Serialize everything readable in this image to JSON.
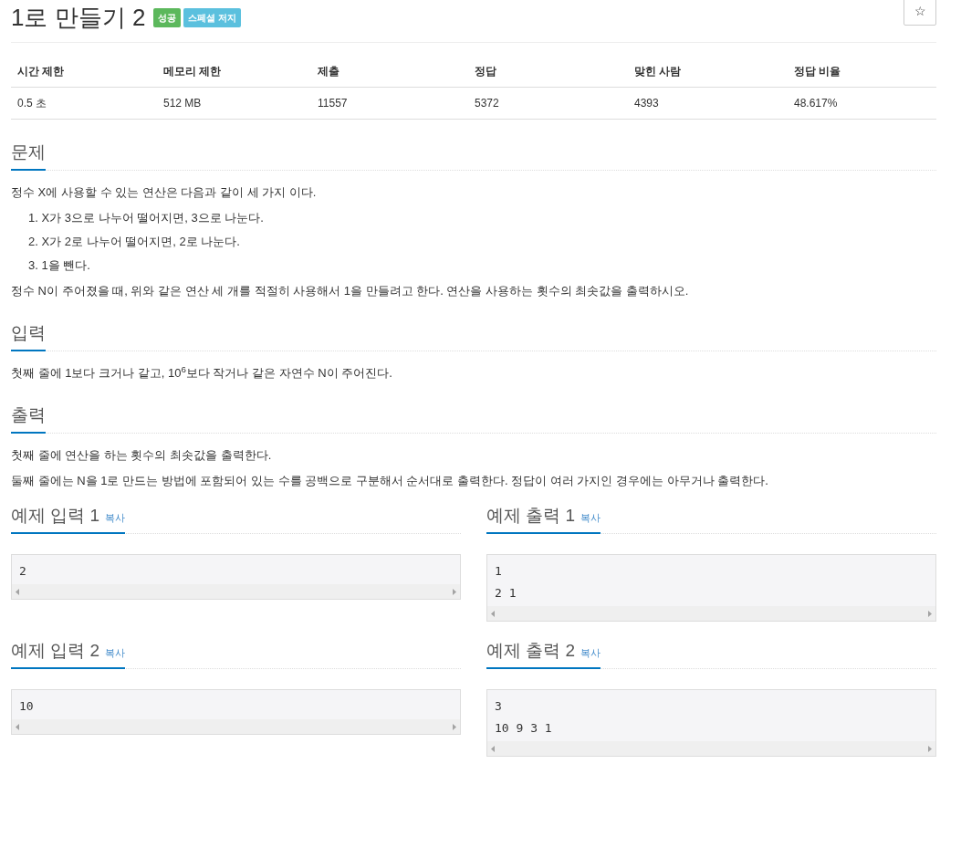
{
  "title": "1로 만들기 2",
  "badges": [
    {
      "label": "성공",
      "color": "#5cb85c"
    },
    {
      "label": "스페셜 저지",
      "color": "#5bc0de"
    }
  ],
  "star_button": "☆",
  "stats": {
    "columns": [
      "시간 제한",
      "메모리 제한",
      "제출",
      "정답",
      "맞힌 사람",
      "정답 비율"
    ],
    "values": [
      "0.5 초",
      "512 MB",
      "11557",
      "5372",
      "4393",
      "48.617%"
    ]
  },
  "sections": [
    {
      "heading": "문제",
      "blocks": [
        {
          "kind": "paragraph",
          "text": "정수 X에 사용할 수 있는 연산은 다음과 같이 세 가지 이다."
        },
        {
          "kind": "list",
          "items": [
            "1. X가 3으로 나누어 떨어지면, 3으로 나눈다.",
            "2. X가 2로 나누어 떨어지면, 2로 나눈다.",
            "3. 1을 뺀다."
          ]
        },
        {
          "kind": "paragraph",
          "text": "정수 N이 주어졌을 때, 위와 같은 연산 세 개를 적절히 사용해서 1을 만들려고 한다. 연산을 사용하는 횟수의 최솟값을 출력하시오."
        }
      ]
    },
    {
      "heading": "입력",
      "blocks": [
        {
          "kind": "paragraph",
          "text": "첫째 줄에 1보다 크거나 같고, 10$^{6}$보다 작거나 같은 자연수 N이 주어진다."
        }
      ]
    },
    {
      "heading": "출력",
      "blocks": [
        {
          "kind": "paragraph",
          "text": "첫째 줄에 연산을 하는 횟수의 최솟값을 출력한다."
        },
        {
          "kind": "paragraph",
          "text": "둘째 줄에는 N을 1로 만드는 방법에 포함되어 있는 수를 공백으로 구분해서 순서대로 출력한다. 정답이 여러 가지인 경우에는 아무거나 출력한다."
        }
      ]
    }
  ],
  "samples": [
    {
      "heading": "예제 입력 1",
      "copy": "복사",
      "lines": [
        "2"
      ]
    },
    {
      "heading": "예제 출력 1",
      "copy": "복사",
      "lines": [
        "1",
        "2 1"
      ]
    },
    {
      "heading": "예제 입력 2",
      "copy": "복사",
      "lines": [
        "10"
      ]
    },
    {
      "heading": "예제 출력 2",
      "copy": "복사",
      "lines": [
        "3",
        "10 9 3 1"
      ]
    }
  ]
}
